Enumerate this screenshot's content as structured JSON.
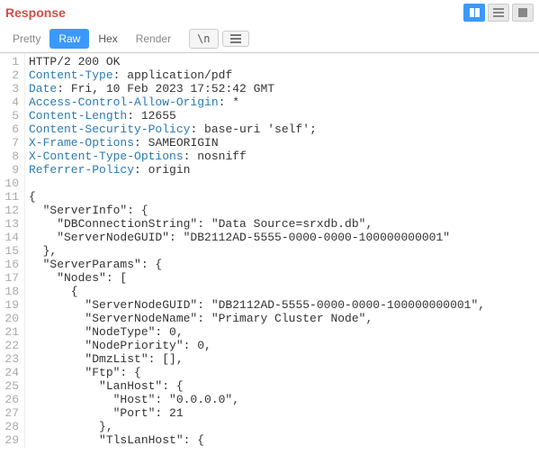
{
  "title": "Response",
  "tabs": {
    "pretty": "Pretty",
    "raw": "Raw",
    "hex": "Hex",
    "render": "Render"
  },
  "newline_label": "\\n",
  "lines": [
    {
      "type": "status",
      "text": "HTTP/2 200 OK"
    },
    {
      "type": "header",
      "name": "Content-Type",
      "value": "application/pdf"
    },
    {
      "type": "header",
      "name": "Date",
      "value": "Fri, 10 Feb 2023 17:52:42 GMT"
    },
    {
      "type": "header",
      "name": "Access-Control-Allow-Origin",
      "value": "*"
    },
    {
      "type": "header",
      "name": "Content-Length",
      "value": "12655"
    },
    {
      "type": "header",
      "name": "Content-Security-Policy",
      "value": "base-uri 'self';"
    },
    {
      "type": "header",
      "name": "X-Frame-Options",
      "value": "SAMEORIGIN"
    },
    {
      "type": "header",
      "name": "X-Content-Type-Options",
      "value": "nosniff"
    },
    {
      "type": "header",
      "name": "Referrer-Policy",
      "value": "origin"
    },
    {
      "type": "body",
      "text": ""
    },
    {
      "type": "body",
      "text": "{"
    },
    {
      "type": "body",
      "text": "  \"ServerInfo\": {"
    },
    {
      "type": "body",
      "text": "    \"DBConnectionString\": \"Data Source=srxdb.db\","
    },
    {
      "type": "body",
      "text": "    \"ServerNodeGUID\": \"DB2112AD-5555-0000-0000-100000000001\""
    },
    {
      "type": "body",
      "text": "  },"
    },
    {
      "type": "body",
      "text": "  \"ServerParams\": {"
    },
    {
      "type": "body",
      "text": "    \"Nodes\": ["
    },
    {
      "type": "body",
      "text": "      {"
    },
    {
      "type": "body",
      "text": "        \"ServerNodeGUID\": \"DB2112AD-5555-0000-0000-100000000001\","
    },
    {
      "type": "body",
      "text": "        \"ServerNodeName\": \"Primary Cluster Node\","
    },
    {
      "type": "body",
      "text": "        \"NodeType\": 0,"
    },
    {
      "type": "body",
      "text": "        \"NodePriority\": 0,"
    },
    {
      "type": "body",
      "text": "        \"DmzList\": [],"
    },
    {
      "type": "body",
      "text": "        \"Ftp\": {"
    },
    {
      "type": "body",
      "text": "          \"LanHost\": {"
    },
    {
      "type": "body",
      "text": "            \"Host\": \"0.0.0.0\","
    },
    {
      "type": "body",
      "text": "            \"Port\": 21"
    },
    {
      "type": "body",
      "text": "          },"
    },
    {
      "type": "body",
      "text": "          \"TlsLanHost\": {"
    }
  ]
}
